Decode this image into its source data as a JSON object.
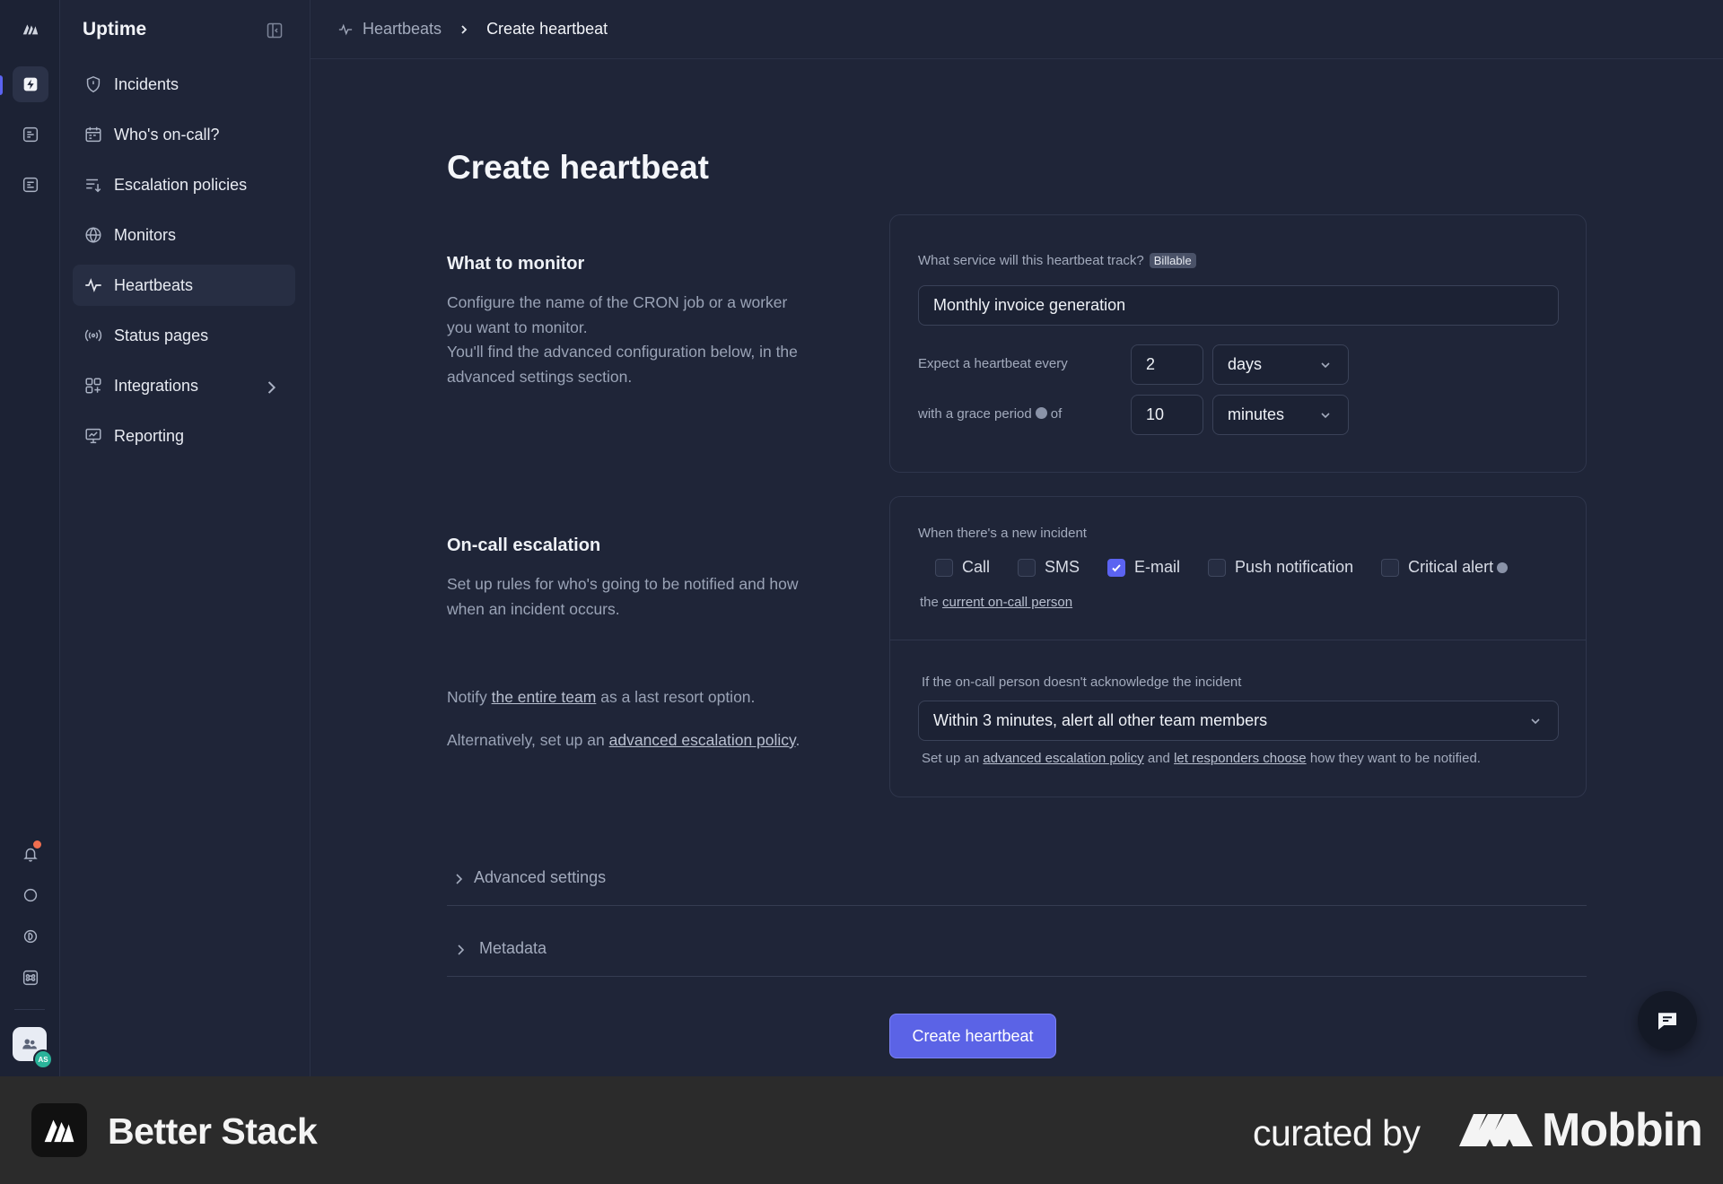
{
  "app": {
    "title": "Uptime"
  },
  "sidebar": {
    "items": [
      {
        "label": "Incidents",
        "icon": "shield-icon"
      },
      {
        "label": "Who's on-call?",
        "icon": "calendar-icon"
      },
      {
        "label": "Escalation policies",
        "icon": "list-arrow-icon"
      },
      {
        "label": "Monitors",
        "icon": "globe-icon"
      },
      {
        "label": "Heartbeats",
        "icon": "pulse-icon",
        "active": true
      },
      {
        "label": "Status pages",
        "icon": "broadcast-icon"
      },
      {
        "label": "Integrations",
        "icon": "grid-plus-icon",
        "has_chevron": true
      },
      {
        "label": "Reporting",
        "icon": "chart-board-icon"
      }
    ]
  },
  "breadcrumb": {
    "parent": "Heartbeats",
    "current": "Create heartbeat"
  },
  "page": {
    "title": "Create heartbeat"
  },
  "what_to_monitor": {
    "heading": "What to monitor",
    "description_1": "Configure the name of the CRON job or a worker you want to monitor.",
    "description_2": "You'll find the advanced configuration below, in the advanced settings section.",
    "service_label": "What service will this heartbeat track?",
    "billable_badge": "Billable",
    "service_value": "Monthly invoice generation",
    "expect_label": "Expect a heartbeat every",
    "expect_value": "2",
    "expect_unit": "days",
    "grace_label_pre": "with a grace period",
    "grace_label_post": "of",
    "grace_value": "10",
    "grace_unit": "minutes"
  },
  "escalation": {
    "heading": "On-call escalation",
    "description": "Set up rules for who's going to be notified and how when an incident occurs.",
    "notify_pre": "Notify",
    "notify_link": "the entire team",
    "notify_post": "as a last resort option.",
    "alt_pre": "Alternatively, set up an",
    "alt_link": "advanced escalation policy",
    "alt_post": ".",
    "new_incident_label": "When there's a new incident",
    "channels": [
      {
        "label": "Call",
        "checked": false
      },
      {
        "label": "SMS",
        "checked": false
      },
      {
        "label": "E-mail",
        "checked": true
      },
      {
        "label": "Push notification",
        "checked": false
      },
      {
        "label": "Critical alert",
        "checked": false
      }
    ],
    "recipient_pre": "the",
    "recipient_link": "current on-call person",
    "no_ack_label": "If the on-call person doesn't acknowledge the incident",
    "no_ack_value": "Within 3 minutes, alert all other team members",
    "footer_pre": "Set up an",
    "footer_link_1": "advanced escalation policy",
    "footer_mid": "and",
    "footer_link_2": "let responders choose",
    "footer_post": "how they want to be notified."
  },
  "sections": {
    "advanced": "Advanced settings",
    "metadata": "Metadata"
  },
  "actions": {
    "submit": "Create heartbeat"
  },
  "user": {
    "initials": "AS"
  },
  "footer": {
    "brand": "Better Stack",
    "curated": "curated by",
    "mobbin": "Mobbin"
  },
  "colors": {
    "accent": "#5b63f1",
    "background": "#1f2538",
    "notification": "#f06e4f"
  }
}
